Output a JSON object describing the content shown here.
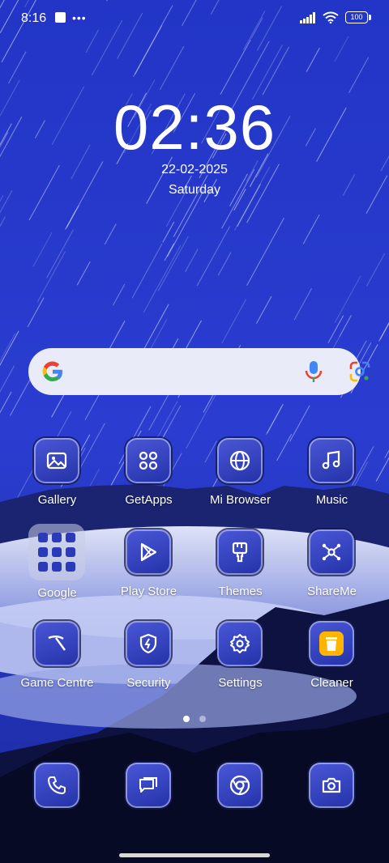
{
  "status_bar": {
    "time": "8:16",
    "battery": "100",
    "left_icons": [
      "square-notification-icon",
      "more-dots-icon"
    ],
    "right_icons": [
      "signal-icon",
      "wifi-icon",
      "battery-icon"
    ]
  },
  "clock": {
    "time": "02:36",
    "date": "22-02-2025",
    "day": "Saturday"
  },
  "search": {
    "icons": [
      "google-g-icon",
      "microphone-icon",
      "google-lens-icon"
    ]
  },
  "apps": [
    {
      "label": "Gallery",
      "icon": "gallery-icon"
    },
    {
      "label": "GetApps",
      "icon": "getapps-icon"
    },
    {
      "label": "Mi Browser",
      "icon": "globe-icon"
    },
    {
      "label": "Music",
      "icon": "music-note-icon"
    },
    {
      "label": "Google",
      "icon": "folder-icon"
    },
    {
      "label": "Play Store",
      "icon": "play-store-icon"
    },
    {
      "label": "Themes",
      "icon": "brush-icon"
    },
    {
      "label": "ShareMe",
      "icon": "share-nodes-icon"
    },
    {
      "label": "Game Centre",
      "icon": "game-centre-icon"
    },
    {
      "label": "Security",
      "icon": "shield-icon"
    },
    {
      "label": "Settings",
      "icon": "gear-icon"
    },
    {
      "label": "Cleaner",
      "icon": "trash-icon"
    }
  ],
  "dock": [
    {
      "icon": "phone-icon"
    },
    {
      "icon": "messages-icon"
    },
    {
      "icon": "chrome-icon"
    },
    {
      "icon": "camera-icon"
    }
  ],
  "pages": {
    "count": 2,
    "current": 1
  },
  "colors": {
    "sky": "#1b2fb8",
    "tile": "#3542c0",
    "search_bg": "#e9ecf8",
    "cleaner": "#ffb400"
  }
}
